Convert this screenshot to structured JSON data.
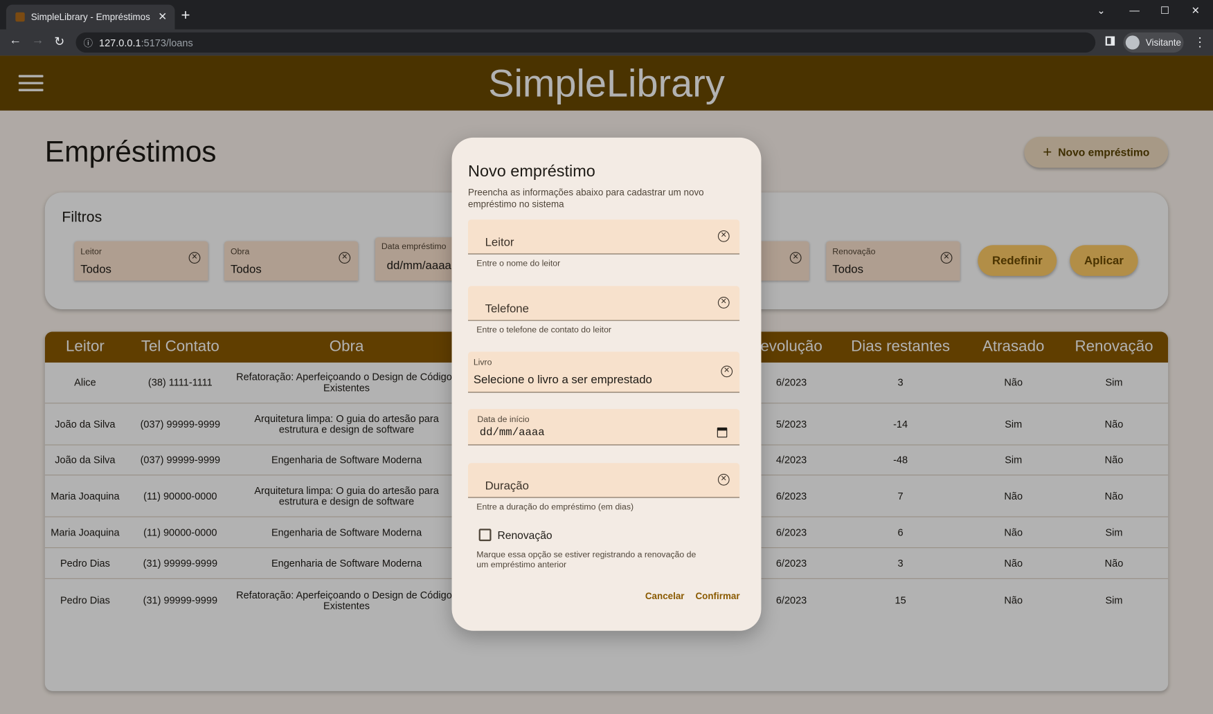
{
  "browser": {
    "tab_title": "SimpleLibrary - Empréstimos",
    "url_host": "127.0.0.1",
    "url_path": ":5173/loans",
    "profile": "Visitante"
  },
  "app": {
    "title": "SimpleLibrary",
    "page_title": "Empréstimos",
    "new_loan_button": "Novo empréstimo"
  },
  "filters": {
    "title": "Filtros",
    "fields": [
      {
        "label": "Leitor",
        "value": "Todos"
      },
      {
        "label": "Obra",
        "value": "Todos"
      },
      {
        "label": "Data empréstimo",
        "value": "dd/mm/aaaa"
      },
      {
        "label": "Renovação",
        "value": "Todos"
      }
    ],
    "reset": "Redefinir",
    "apply": "Aplicar"
  },
  "table": {
    "headers": [
      "Leitor",
      "Tel Contato",
      "Obra",
      "evolução",
      "Dias restantes",
      "Atrasado",
      "Renovação"
    ],
    "rows": [
      {
        "leitor": "Alice",
        "tel": "(38) 1111-1111",
        "obra": "Refatoração: Aperfeiçoando o Design de Códigos Existentes",
        "dev": "6/2023",
        "dias": "3",
        "atrasado": "Não",
        "renov": "Sim"
      },
      {
        "leitor": "João da Silva",
        "tel": "(037) 99999-9999",
        "obra": "Arquitetura limpa: O guia do artesão para estrutura e design de software",
        "dev": "5/2023",
        "dias": "-14",
        "atrasado": "Sim",
        "renov": "Não"
      },
      {
        "leitor": "João da Silva",
        "tel": "(037) 99999-9999",
        "obra": "Engenharia de Software Moderna",
        "dev": "4/2023",
        "dias": "-48",
        "atrasado": "Sim",
        "renov": "Não"
      },
      {
        "leitor": "Maria Joaquina",
        "tel": "(11) 90000-0000",
        "obra": "Arquitetura limpa: O guia do artesão para estrutura e design de software",
        "dev": "6/2023",
        "dias": "7",
        "atrasado": "Não",
        "renov": "Não"
      },
      {
        "leitor": "Maria Joaquina",
        "tel": "(11) 90000-0000",
        "obra": "Engenharia de Software Moderna",
        "dev": "6/2023",
        "dias": "6",
        "atrasado": "Não",
        "renov": "Sim"
      },
      {
        "leitor": "Pedro Dias",
        "tel": "(31) 99999-9999",
        "obra": "Engenharia de Software Moderna",
        "dev": "6/2023",
        "dias": "3",
        "atrasado": "Não",
        "renov": "Não"
      },
      {
        "leitor": "Pedro Dias",
        "tel": "(31) 99999-9999",
        "obra": "Refatoração: Aperfeiçoando o Design de Códigos Existentes",
        "dev": "6/2023",
        "dias": "15",
        "atrasado": "Não",
        "renov": "Sim"
      }
    ]
  },
  "dialog": {
    "title": "Novo empréstimo",
    "subtitle": "Preencha as informações abaixo para cadastrar um novo empréstimo no sistema",
    "leitor_placeholder": "Leitor",
    "leitor_help": "Entre o nome do leitor",
    "telefone_placeholder": "Telefone",
    "telefone_help": "Entre o telefone de contato do leitor",
    "livro_label": "Livro",
    "livro_value": "Selecione o livro a ser emprestado",
    "data_label": "Data de início",
    "data_value": "dd/mm/aaaa",
    "duracao_placeholder": "Duração",
    "duracao_help": "Entre a duração do empréstimo (em dias)",
    "renovacao_label": "Renovação",
    "renovacao_help": "Marque essa opção se estiver registrando a renovação de um empréstimo anterior",
    "cancel": "Cancelar",
    "confirm": "Confirmar"
  }
}
